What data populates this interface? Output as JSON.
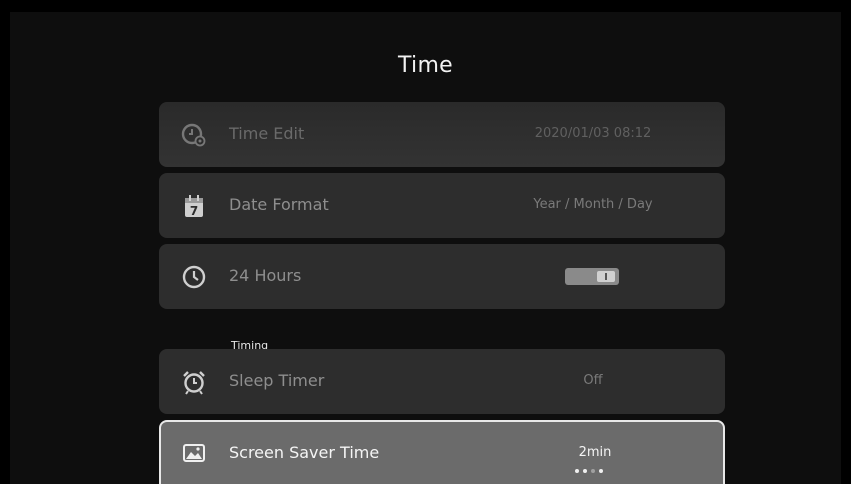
{
  "title": "Time",
  "rows": {
    "time_edit": {
      "label": "Time Edit",
      "value": "2020/01/03 08:12",
      "icon": "clock-gear-icon"
    },
    "date_format": {
      "label": "Date Format",
      "value": "Year / Month / Day",
      "icon": "calendar-icon"
    },
    "hours24": {
      "label": "24 Hours",
      "toggle_on": true,
      "icon": "clock-icon"
    },
    "sleep_timer": {
      "label": "Sleep Timer",
      "value": "Off",
      "icon": "alarm-clock-icon"
    },
    "screen_saver": {
      "label": "Screen Saver Time",
      "value": "2min",
      "icon": "picture-icon",
      "page_index": 2,
      "page_count": 4
    }
  },
  "section_timing": "Timing",
  "colors": {
    "background": "#000000",
    "row": "#2d2d2d",
    "focused_row": "#6b6b6b",
    "focus_border": "#e8e8e8"
  }
}
